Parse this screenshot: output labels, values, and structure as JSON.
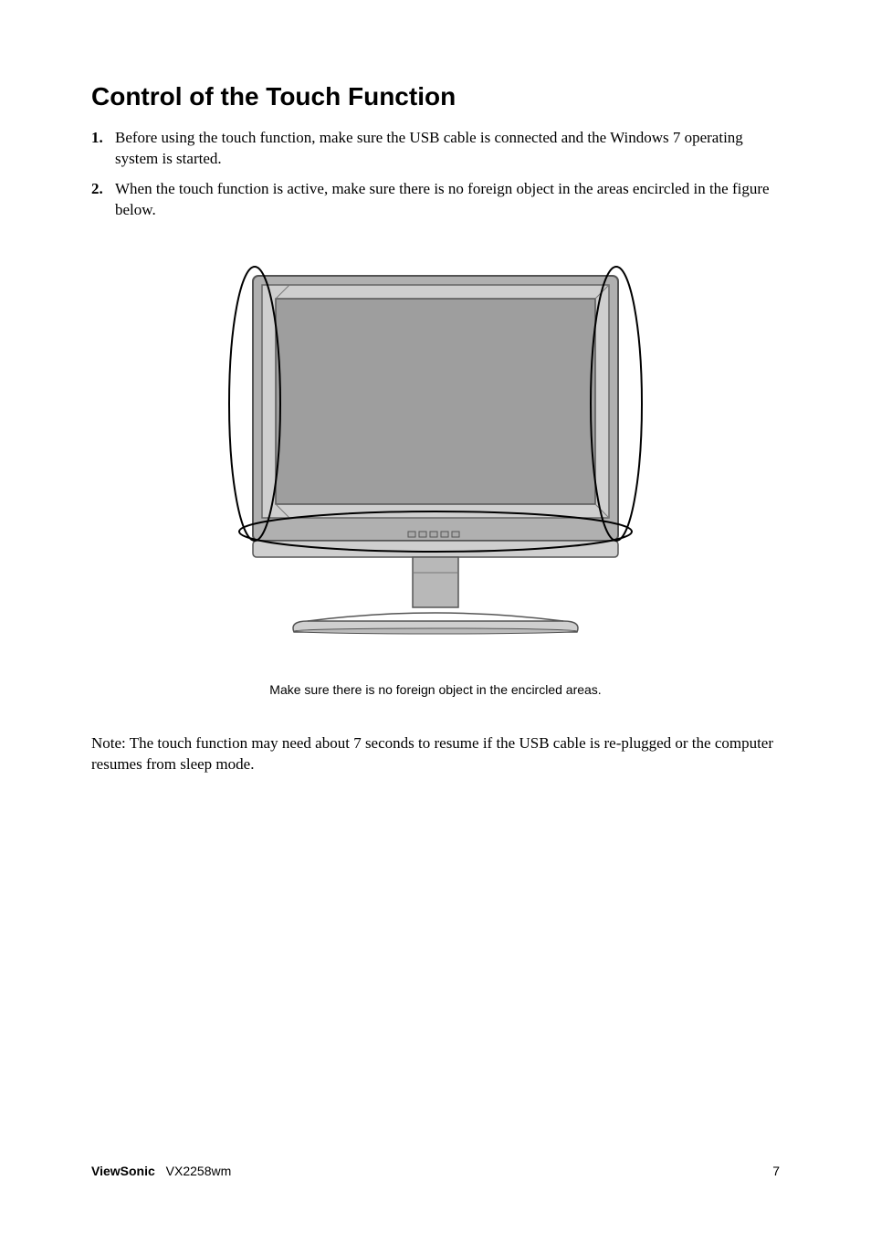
{
  "title": "Control of the Touch Function",
  "steps": [
    {
      "num": "1.",
      "text": "Before using the touch function, make sure the USB cable is connected and the Windows 7 operating system is started."
    },
    {
      "num": "2.",
      "text": "When the touch function is active, make sure there is no foreign object in the areas encircled in the figure below."
    }
  ],
  "caption": "Make sure there is no foreign object in the encircled areas.",
  "note": "Note: The touch function may need about 7 seconds to resume if the USB cable is re-plugged or the computer resumes from sleep mode.",
  "footer": {
    "brand_bold": "ViewSonic",
    "brand_model": "VX2258wm",
    "page_number": "7"
  }
}
